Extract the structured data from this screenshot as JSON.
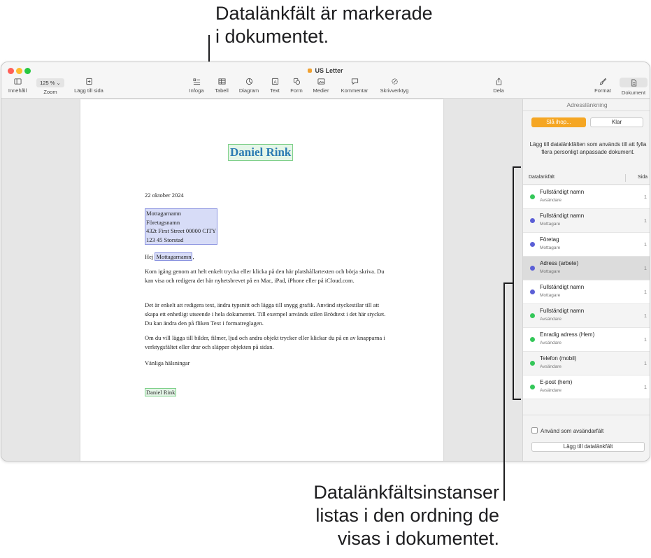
{
  "callouts": {
    "top": [
      "Datalänkfält är markerade",
      "i dokumentet."
    ],
    "bottom": [
      "Datalänkfältsinstanser",
      "listas i den ordning de",
      "visas i dokumentet."
    ]
  },
  "window": {
    "title": "US Letter"
  },
  "toolbar": {
    "content": "Innehåll",
    "zoom_value": "125 %",
    "zoom": "Zoom",
    "add_page": "Lägg till sida",
    "insert": "Infoga",
    "table": "Tabell",
    "chart": "Diagram",
    "text": "Text",
    "shape": "Form",
    "media": "Medier",
    "comment": "Kommentar",
    "writing_tools": "Skrivverktyg",
    "share": "Dela",
    "format": "Format",
    "document": "Dokument"
  },
  "document": {
    "sender_title": "Daniel Rink",
    "date": "22 oktober 2024",
    "address": [
      "Mottagarnamn",
      "Företagsnamn",
      "432t First Street 00000 CITY",
      "123 45 Storstad"
    ],
    "greeting_prefix": "Hej ",
    "greeting_field": "Mottagarnamn",
    "greeting_suffix": ",",
    "para1": "Kom igång genom att helt enkelt trycka eller klicka på den här platshållartexten och börja skriva. Du kan visa och redigera det här nyhetsbrevet på en Mac, iPad, iPhone eller på iCloud.com.",
    "para2": "Det är enkelt att redigera text, ändra typsnitt och lägga till snygg grafik. Använd styckestilar till att skapa ett enhetligt utseende i hela dokumentet. Till exempel används stilen Brödtext i det här stycket. Du kan ändra den på fliken Text i formatreglagen.",
    "para3": "Om du vill lägga till bilder, filmer, ljud och andra objekt trycker eller klickar du på en av knapparna i verktygsfältet eller drar och släpper objekten på sidan.",
    "closing": "Vänliga hälsningar",
    "signature": "Daniel Rink"
  },
  "sidebar": {
    "header": "Adresslänkning",
    "merge_button": "Slå ihop...",
    "done_button": "Klar",
    "description": "Lägg till datalänkfälten som används till att fylla flera personligt anpassade dokument.",
    "col_field": "Datalänkfält",
    "col_page": "Sida",
    "fields": [
      {
        "name": "Fullständigt namn",
        "sub": "Avsändare",
        "page": "1",
        "color": "#34c759"
      },
      {
        "name": "Fullständigt namn",
        "sub": "Mottagare",
        "page": "1",
        "color": "#5b5fd6"
      },
      {
        "name": "Företag",
        "sub": "Mottagare",
        "page": "1",
        "color": "#5b5fd6"
      },
      {
        "name": "Adress (arbete)",
        "sub": "Mottagare",
        "page": "1",
        "color": "#5b5fd6"
      },
      {
        "name": "Fullständigt namn",
        "sub": "Mottagare",
        "page": "1",
        "color": "#5b5fd6"
      },
      {
        "name": "Fullständigt namn",
        "sub": "Avsändare",
        "page": "1",
        "color": "#34c759"
      },
      {
        "name": "Enradig adress (Hem)",
        "sub": "Avsändare",
        "page": "1",
        "color": "#34c759"
      },
      {
        "name": "Telefon (mobil)",
        "sub": "Avsändare",
        "page": "1",
        "color": "#34c759"
      },
      {
        "name": "E-post (hem)",
        "sub": "Avsändare",
        "page": "1",
        "color": "#34c759"
      }
    ],
    "use_as_sender": "Använd som avsändarfält",
    "add_field_button": "Lägg till datalänkfält"
  }
}
